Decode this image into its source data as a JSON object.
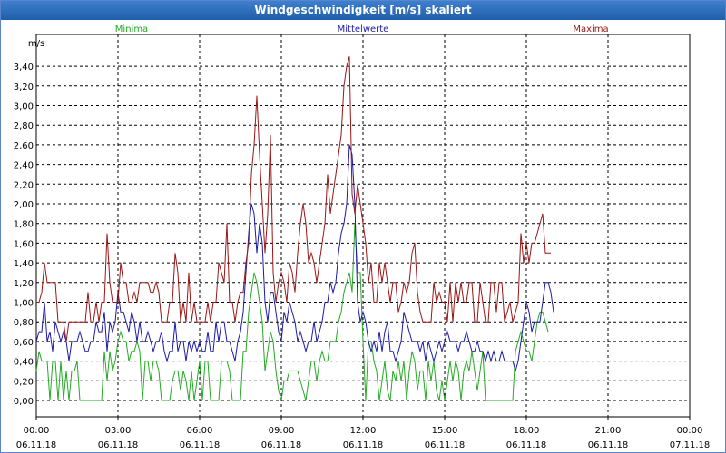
{
  "window": {
    "title": "Windgeschwindigkeit [m/s] skaliert"
  },
  "colors": {
    "min": "#22aa22",
    "mean": "#1a1aaa",
    "max": "#9a1515",
    "grid": "#000000",
    "frame": "#5a86c9"
  },
  "chart_data": {
    "type": "line",
    "title": "Windgeschwindigkeit [m/s] skaliert",
    "ylabel": "m/s",
    "xlabel": "",
    "ylim": [
      -0.1,
      3.6
    ],
    "yticks": [
      "0,00",
      "0,20",
      "0,40",
      "0,60",
      "0,80",
      "1,00",
      "1,20",
      "1,40",
      "1,60",
      "1,80",
      "2,00",
      "2,20",
      "2,40",
      "2,60",
      "2,80",
      "3,00",
      "3,20",
      "3,40"
    ],
    "xticks": [
      {
        "time": "00:00",
        "date": "06.11.18"
      },
      {
        "time": "03:00",
        "date": "06.11.18"
      },
      {
        "time": "06:00",
        "date": "06.11.18"
      },
      {
        "time": "09:00",
        "date": "06.11.18"
      },
      {
        "time": "12:00",
        "date": "06.11.18"
      },
      {
        "time": "15:00",
        "date": "06.11.18"
      },
      {
        "time": "18:00",
        "date": "06.11.18"
      },
      {
        "time": "21:00",
        "date": "06.11.18"
      },
      {
        "time": "00:00",
        "date": "07.11.18"
      }
    ],
    "xlim_hours": [
      0,
      24
    ],
    "grid": true,
    "legend_position": "top",
    "sample_interval_hours": 0.1,
    "series": [
      {
        "name": "Minima",
        "color": "#22aa22",
        "values": [
          0.3,
          0.5,
          0.4,
          0.4,
          0.4,
          0.0,
          0.4,
          0.4,
          0.0,
          0.4,
          0.0,
          0.3,
          0.0,
          0.3,
          0.3,
          0.4,
          0.0,
          0.0,
          0.0,
          0.0,
          0.0,
          0.0,
          0.0,
          0.0,
          0.0,
          0.5,
          0.2,
          0.5,
          0.3,
          0.4,
          0.6,
          0.7,
          0.6,
          0.6,
          0.4,
          0.5,
          0.5,
          0.6,
          0.5,
          0.0,
          0.4,
          0.4,
          0.2,
          0.4,
          0.4,
          0.3,
          0.0,
          0.0,
          0.0,
          0.0,
          0.2,
          0.3,
          0.3,
          0.1,
          0.3,
          0.2,
          0.0,
          0.3,
          0.0,
          0.2,
          0.4,
          0.0,
          0.4,
          0.4,
          0.0,
          0.0,
          0.0,
          0.0,
          0.4,
          0.4,
          0.4,
          0.3,
          0.0,
          0.0,
          0.0,
          0.0,
          0.5,
          0.5,
          0.9,
          1.1,
          1.3,
          1.2,
          1.0,
          0.8,
          0.3,
          0.5,
          0.7,
          0.6,
          0.3,
          0.1,
          0.0,
          0.2,
          0.2,
          0.3,
          0.3,
          0.3,
          0.3,
          0.2,
          0.1,
          0.0,
          0.2,
          0.4,
          0.4,
          0.2,
          0.4,
          0.5,
          0.4,
          0.4,
          0.6,
          0.6,
          0.6,
          0.8,
          0.9,
          1.1,
          1.2,
          1.3,
          1.1,
          1.8,
          1.3,
          1.3,
          0.6,
          0.0,
          0.6,
          0.6,
          0.4,
          0.3,
          0.0,
          0.2,
          0.4,
          0.1,
          0.0,
          0.3,
          0.2,
          0.4,
          0.2,
          0.4,
          0.0,
          0.3,
          0.5,
          0.4,
          0.1,
          0.3,
          0.3,
          0.0,
          0.4,
          0.2,
          0.4,
          0.1,
          0.0,
          0.2,
          0.0,
          0.2,
          0.4,
          0.2,
          0.4,
          0.3,
          0.0,
          0.3,
          0.4,
          0.3,
          0.5,
          0.3,
          0.1,
          0.3,
          0.5,
          0.0,
          0.0,
          0.0,
          0.0,
          0.0,
          0.0,
          0.0,
          0.0,
          0.0,
          0.0,
          0.0,
          0.5,
          0.6,
          0.7,
          0.6,
          0.5,
          0.5,
          0.4,
          0.6,
          0.8,
          0.9,
          0.9,
          0.8,
          0.7
        ]
      },
      {
        "name": "Mittelwerte",
        "color": "#1a1aaa",
        "values": [
          0.6,
          0.7,
          0.7,
          1.0,
          0.6,
          0.7,
          0.5,
          0.8,
          0.7,
          0.6,
          0.7,
          0.6,
          0.4,
          0.6,
          0.6,
          0.6,
          0.7,
          0.6,
          0.5,
          0.5,
          0.6,
          0.6,
          0.8,
          0.7,
          0.7,
          0.9,
          0.5,
          0.8,
          0.7,
          0.8,
          1.1,
          0.9,
          0.9,
          0.8,
          0.7,
          0.9,
          0.8,
          0.6,
          0.8,
          0.6,
          0.6,
          0.7,
          0.6,
          0.5,
          0.6,
          0.6,
          0.7,
          0.5,
          0.4,
          0.5,
          0.5,
          0.8,
          0.5,
          0.6,
          0.6,
          0.4,
          0.6,
          0.5,
          0.6,
          0.5,
          0.6,
          0.5,
          0.5,
          0.7,
          0.5,
          0.5,
          0.8,
          0.6,
          0.8,
          0.8,
          0.6,
          0.6,
          0.5,
          0.4,
          0.6,
          0.7,
          0.9,
          1.3,
          1.7,
          2.0,
          1.9,
          1.5,
          1.8,
          1.6,
          1.0,
          0.8,
          1.1,
          1.1,
          0.9,
          0.7,
          0.6,
          0.9,
          0.8,
          1.0,
          0.9,
          0.8,
          0.6,
          0.7,
          0.6,
          0.5,
          0.6,
          0.6,
          0.8,
          0.6,
          0.7,
          0.8,
          1.0,
          1.0,
          1.2,
          1.1,
          1.2,
          1.5,
          1.7,
          1.8,
          2.0,
          2.6,
          2.5,
          2.0,
          1.0,
          0.8,
          0.9,
          0.8,
          0.6,
          0.5,
          0.6,
          0.5,
          0.7,
          0.5,
          0.7,
          0.8,
          0.5,
          0.5,
          0.4,
          0.5,
          0.6,
          0.9,
          0.8,
          0.7,
          0.6,
          0.6,
          0.6,
          0.5,
          0.6,
          0.4,
          0.6,
          0.5,
          0.4,
          0.5,
          0.6,
          0.5,
          0.6,
          0.7,
          0.6,
          0.6,
          0.6,
          0.5,
          0.6,
          0.6,
          0.7,
          0.6,
          0.5,
          0.5,
          0.6,
          0.5,
          0.5,
          0.4,
          0.5,
          0.4,
          0.5,
          0.4,
          0.4,
          0.5,
          0.4,
          0.4,
          0.4,
          0.4,
          0.3,
          0.4,
          0.6,
          0.8,
          1.0,
          0.9,
          0.7,
          0.8,
          0.8,
          0.8,
          1.0,
          1.2,
          1.2,
          1.1,
          0.9
        ]
      },
      {
        "name": "Maxima",
        "color": "#9a1515",
        "values": [
          1.0,
          1.0,
          1.1,
          1.4,
          1.2,
          1.2,
          1.2,
          1.2,
          0.8,
          0.8,
          0.8,
          0.6,
          0.8,
          0.8,
          0.8,
          0.8,
          0.8,
          0.8,
          0.8,
          1.1,
          0.8,
          0.8,
          1.0,
          0.8,
          1.0,
          1.0,
          1.7,
          1.2,
          1.0,
          1.0,
          1.0,
          1.4,
          1.2,
          1.2,
          1.0,
          1.0,
          1.1,
          1.0,
          1.2,
          1.2,
          1.2,
          1.2,
          1.1,
          1.1,
          1.2,
          1.1,
          0.8,
          0.8,
          0.8,
          1.0,
          1.0,
          1.5,
          1.3,
          0.8,
          1.0,
          0.8,
          1.3,
          0.8,
          1.0,
          0.8,
          0.8,
          0.8,
          0.8,
          1.0,
          0.8,
          1.0,
          1.0,
          1.4,
          1.3,
          1.2,
          1.8,
          1.0,
          1.0,
          0.8,
          1.0,
          1.1,
          1.1,
          1.4,
          1.6,
          2.3,
          2.6,
          3.1,
          2.5,
          2.0,
          1.5,
          1.9,
          2.7,
          1.3,
          1.0,
          1.2,
          1.3,
          1.2,
          1.0,
          1.4,
          1.3,
          1.1,
          1.5,
          1.8,
          2.0,
          1.8,
          1.4,
          1.5,
          1.4,
          1.2,
          1.4,
          1.6,
          1.8,
          2.3,
          1.9,
          2.1,
          2.3,
          2.5,
          2.7,
          3.2,
          3.4,
          3.5,
          2.1,
          1.9,
          2.2,
          2.0,
          1.8,
          1.6,
          1.2,
          1.4,
          1.0,
          1.0,
          1.4,
          1.2,
          1.4,
          1.2,
          1.0,
          1.2,
          1.2,
          0.9,
          1.0,
          1.2,
          1.1,
          1.2,
          1.5,
          1.6,
          1.1,
          0.9,
          0.8,
          0.8,
          0.8,
          0.8,
          1.2,
          1.0,
          1.1,
          1.0,
          1.0,
          0.8,
          1.2,
          0.8,
          1.2,
          1.0,
          1.2,
          1.0,
          1.0,
          1.2,
          1.2,
          0.8,
          0.8,
          1.2,
          1.0,
          0.8,
          0.8,
          1.2,
          1.2,
          0.9,
          1.2,
          1.2,
          0.8,
          0.9,
          1.0,
          0.8,
          0.9,
          1.0,
          1.7,
          1.4,
          1.6,
          1.4,
          1.6,
          1.6,
          1.7,
          1.8,
          1.9,
          1.5,
          1.5,
          1.5
        ]
      }
    ]
  }
}
